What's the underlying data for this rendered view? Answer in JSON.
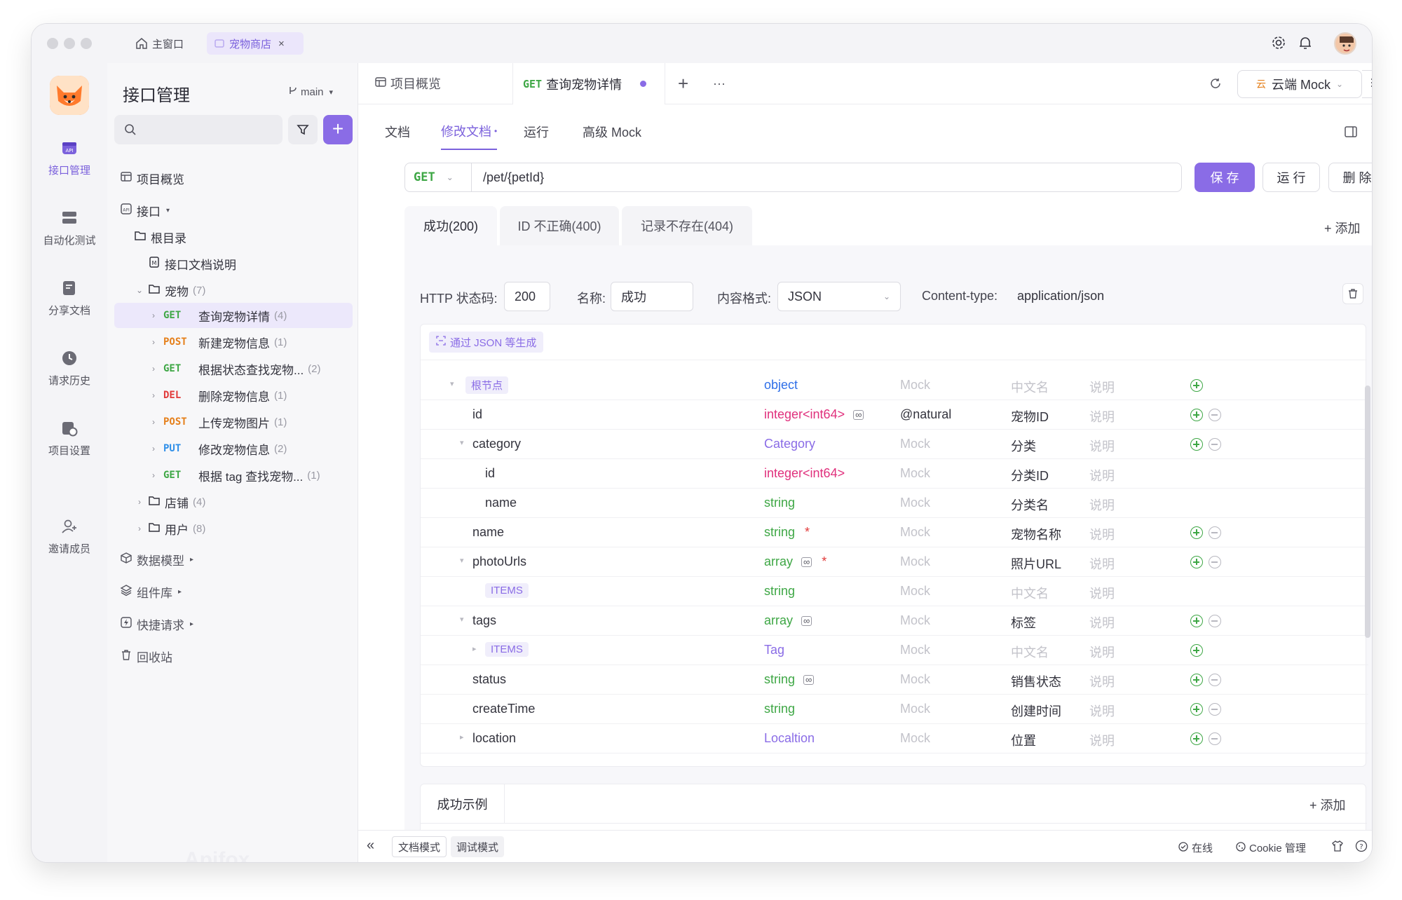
{
  "titlebar": {
    "home_tab": "主窗口",
    "project_tab": "宠物商店",
    "close": "×"
  },
  "rail": {
    "items": [
      {
        "label": "接口管理",
        "icon": "api-manage-icon"
      },
      {
        "label": "自动化测试",
        "icon": "auto-test-icon"
      },
      {
        "label": "分享文档",
        "icon": "share-doc-icon"
      },
      {
        "label": "请求历史",
        "icon": "history-icon"
      },
      {
        "label": "项目设置",
        "icon": "project-settings-icon"
      },
      {
        "label": "邀请成员",
        "icon": "invite-member-icon"
      }
    ],
    "watermark": "Apifox"
  },
  "sidebar": {
    "title": "接口管理",
    "branch": "main",
    "plus": "+",
    "items": {
      "overview": "项目概览",
      "api": "接口",
      "root": "根目录",
      "doc_readme": "接口文档说明",
      "pets": "宠物",
      "pets_count": "(7)",
      "store": "店铺",
      "store_count": "(4)",
      "user": "用户",
      "user_count": "(8)",
      "models": "数据模型",
      "components": "组件库",
      "quick": "快捷请求",
      "trash": "回收站"
    },
    "endpoints": [
      {
        "method": "GET",
        "name": "查询宠物详情",
        "count": "(4)"
      },
      {
        "method": "POST",
        "name": "新建宠物信息",
        "count": "(1)"
      },
      {
        "method": "GET",
        "name": "根据状态查找宠物...",
        "count": "(2)"
      },
      {
        "method": "DEL",
        "name": "删除宠物信息",
        "count": "(1)"
      },
      {
        "method": "POST",
        "name": "上传宠物图片",
        "count": "(1)"
      },
      {
        "method": "PUT",
        "name": "修改宠物信息",
        "count": "(2)"
      },
      {
        "method": "GET",
        "name": "根据 tag 查找宠物...",
        "count": "(1)"
      }
    ]
  },
  "main": {
    "tabs": {
      "overview": "项目概览",
      "current_method": "GET",
      "current_name": "查询宠物详情",
      "add": "+",
      "more": "···"
    },
    "env": {
      "badge": "云",
      "name": "云端 Mock"
    },
    "subtabs": [
      "文档",
      "修改文档",
      "运行",
      "高级 Mock"
    ],
    "url": {
      "method": "GET",
      "path": "/pet/{petId}"
    },
    "buttons": {
      "save": "保 存",
      "run": "运 行",
      "delete": "删 除"
    },
    "responses": {
      "tabs": [
        "成功(200)",
        "ID 不正确(400)",
        "记录不存在(404)"
      ],
      "add": "+ 添加"
    },
    "fields": {
      "status_label": "HTTP 状态码:",
      "status_value": "200",
      "name_label": "名称:",
      "name_value": "成功",
      "content_label": "内容格式:",
      "content_value": "JSON",
      "ctype_label": "Content-type:",
      "ctype_value": "application/json"
    },
    "generate": "通过 JSON 等生成",
    "schema_rows": [
      {
        "name": "根节点",
        "type": "object",
        "mock": "Mock",
        "cn": "中文名",
        "desc": "说明"
      },
      {
        "name": "id",
        "type": "integer<int64>",
        "mock": "@natural",
        "cn": "宠物ID",
        "desc": "说明"
      },
      {
        "name": "category",
        "type": "Category",
        "mock": "Mock",
        "cn": "分类",
        "desc": "说明"
      },
      {
        "name": "id",
        "type": "integer<int64>",
        "mock": "Mock",
        "cn": "分类ID",
        "desc": "说明"
      },
      {
        "name": "name",
        "type": "string",
        "mock": "Mock",
        "cn": "分类名",
        "desc": "说明"
      },
      {
        "name": "name",
        "type": "string",
        "mock": "Mock",
        "cn": "宠物名称",
        "desc": "说明"
      },
      {
        "name": "photoUrls",
        "type": "array",
        "mock": "Mock",
        "cn": "照片URL",
        "desc": "说明"
      },
      {
        "name": "ITEMS",
        "type": "string",
        "mock": "Mock",
        "cn": "中文名",
        "desc": "说明"
      },
      {
        "name": "tags",
        "type": "array",
        "mock": "Mock",
        "cn": "标签",
        "desc": "说明"
      },
      {
        "name": "ITEMS",
        "type": "Tag",
        "mock": "Mock",
        "cn": "中文名",
        "desc": "说明"
      },
      {
        "name": "status",
        "type": "string",
        "mock": "Mock",
        "cn": "销售状态",
        "desc": "说明"
      },
      {
        "name": "createTime",
        "type": "string",
        "mock": "Mock",
        "cn": "创建时间",
        "desc": "说明"
      },
      {
        "name": "location",
        "type": "Localtion",
        "mock": "Mock",
        "cn": "位置",
        "desc": "说明"
      }
    ],
    "required_mark": "*",
    "example": {
      "title": "成功示例",
      "add": "+ 添加",
      "code": "{"
    }
  },
  "bottom": {
    "collapse": "«",
    "doc_mode": "文档模式",
    "debug_mode": "调试模式",
    "online": "在线",
    "cookie": "Cookie 管理"
  },
  "colors": {
    "accent": "#7b61dc",
    "get": "#3ea745",
    "post": "#e5801c",
    "del": "#e13a3a",
    "put": "#2f8fe8"
  }
}
